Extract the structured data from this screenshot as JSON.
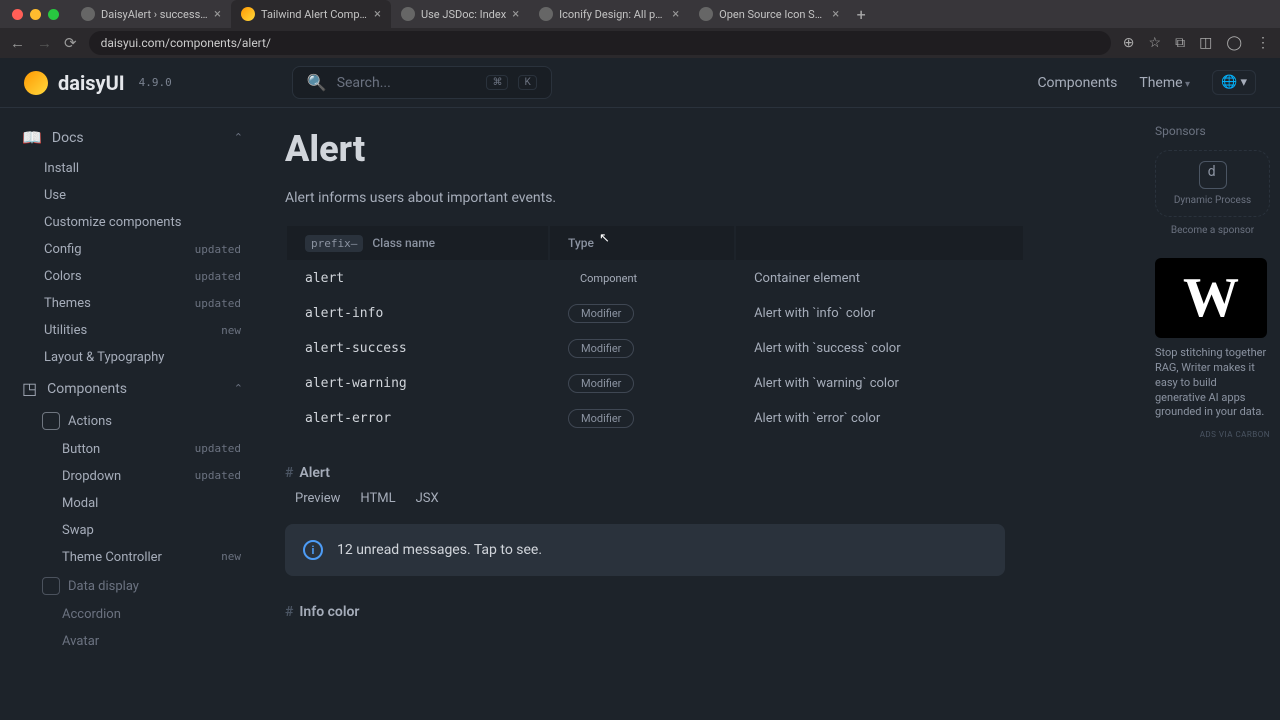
{
  "browser": {
    "tabs": [
      {
        "title": "DaisyAlert › success | Histo"
      },
      {
        "title": "Tailwind Alert Component —"
      },
      {
        "title": "Use JSDoc: Index"
      },
      {
        "title": "Iconify Design: All popular i"
      },
      {
        "title": "Open Source Icon Sets - Ico"
      }
    ],
    "url": "daisyui.com/components/alert/"
  },
  "header": {
    "brand": "daisyUI",
    "version": "4.9.0",
    "search_placeholder": "Search...",
    "kbd1": "⌘",
    "kbd2": "K",
    "nav_components": "Components",
    "nav_theme": "Theme"
  },
  "sidebar": {
    "docs_label": "Docs",
    "components_label": "Components",
    "docs_items": [
      {
        "label": "Install",
        "badge": ""
      },
      {
        "label": "Use",
        "badge": ""
      },
      {
        "label": "Customize components",
        "badge": ""
      },
      {
        "label": "Config",
        "badge": "updated"
      },
      {
        "label": "Colors",
        "badge": "updated"
      },
      {
        "label": "Themes",
        "badge": "updated"
      },
      {
        "label": "Utilities",
        "badge": "new"
      },
      {
        "label": "Layout & Typography",
        "badge": ""
      }
    ],
    "actions_label": "Actions",
    "actions_items": [
      {
        "label": "Button",
        "badge": "updated"
      },
      {
        "label": "Dropdown",
        "badge": "updated"
      },
      {
        "label": "Modal",
        "badge": ""
      },
      {
        "label": "Swap",
        "badge": ""
      },
      {
        "label": "Theme Controller",
        "badge": "new"
      }
    ],
    "data_display_label": "Data display",
    "data_display_items": [
      {
        "label": "Accordion"
      },
      {
        "label": "Avatar"
      }
    ]
  },
  "main": {
    "title": "Alert",
    "desc": "Alert informs users about important events.",
    "table": {
      "prefix": "prefix–",
      "col_class": "Class name",
      "col_type": "Type",
      "rows": [
        {
          "cls": "alert",
          "type": "Component",
          "type_kind": "component",
          "desc": "Container element"
        },
        {
          "cls": "alert-info",
          "type": "Modifier",
          "type_kind": "modifier",
          "desc": "Alert with `info` color"
        },
        {
          "cls": "alert-success",
          "type": "Modifier",
          "type_kind": "modifier",
          "desc": "Alert with `success` color"
        },
        {
          "cls": "alert-warning",
          "type": "Modifier",
          "type_kind": "modifier",
          "desc": "Alert with `warning` color"
        },
        {
          "cls": "alert-error",
          "type": "Modifier",
          "type_kind": "modifier",
          "desc": "Alert with `error` color"
        }
      ]
    },
    "example1_title": "Alert",
    "tabs": {
      "preview": "Preview",
      "html": "HTML",
      "jsx": "JSX"
    },
    "alert_text": "12 unread messages. Tap to see.",
    "example2_title": "Info color"
  },
  "right": {
    "sponsors": "Sponsors",
    "sponsor1": "Dynamic Process",
    "become": "Become a sponsor",
    "ad_text": "Stop stitching together RAG, Writer makes it easy to build generative AI apps grounded in your data.",
    "ad_attr": "ADS VIA CARBON"
  }
}
